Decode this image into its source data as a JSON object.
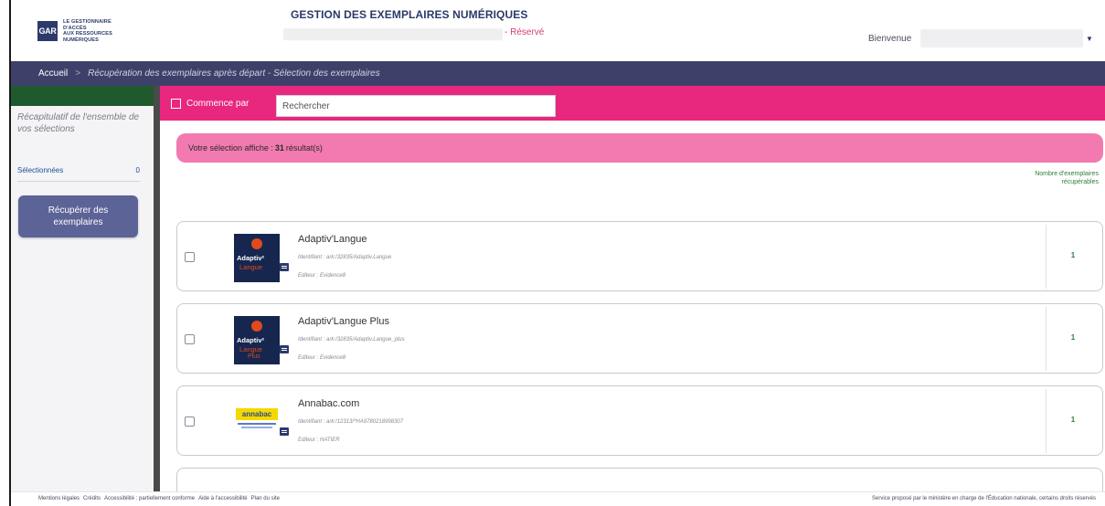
{
  "header": {
    "logo_abbr": "GAR",
    "logo_lines": [
      "LE GESTIONNAIRE",
      "D'ACCÈS",
      "AUX RESSOURCES",
      "NUMÉRIQUES"
    ],
    "title": "GESTION DES EXEMPLAIRES NUMÉRIQUES",
    "reserved": "- Réservé",
    "welcome": "Bienvenue"
  },
  "breadcrumb": {
    "home": "Accueil",
    "separator": ">",
    "current": "Récupération des exemplaires après départ - Sélection des exemplaires"
  },
  "sidebar": {
    "recap": "Récapitulatif de l'ensemble de vos sélections",
    "selected_label": "Sélectionnées",
    "selected_count": "0",
    "recover_button": "Récupérer des exemplaires"
  },
  "search": {
    "commence_label": "Commence par",
    "placeholder": "Rechercher"
  },
  "results": {
    "summary_prefix": "Votre sélection affiche :",
    "count": "31",
    "summary_suffix": "résultat(s)",
    "column_header": "Nombre d'exemplaires récupérables"
  },
  "items": [
    {
      "title": "Adaptiv'Langue",
      "identifier": "Identifiant : ark:/32835/Adaptiv.Langue",
      "publisher": "Editeur : Evidence8",
      "count": "1",
      "logo_lines": [
        "Adaptiv²",
        "Langue",
        ""
      ]
    },
    {
      "title": "Adaptiv'Langue Plus",
      "identifier": "Identifiant : ark:/32835/Adaptiv.Langue_plus",
      "publisher": "Editeur : Evidence8",
      "count": "1",
      "logo_lines": [
        "Adaptiv²",
        "Langue",
        "Plus"
      ]
    },
    {
      "title": "Annabac.com",
      "identifier": "Identifiant : ark:/12313/*HA9780218998307",
      "publisher": "Editeur : HATIER",
      "count": "1",
      "logo_lines": [
        "annabac"
      ]
    }
  ],
  "footer": {
    "links": [
      "Mentions légales",
      "Crédits",
      "Accessibilité : partiellement conforme",
      "Aide à l'accessibilité",
      "Plan du site"
    ],
    "right": "Service proposé par le ministère en charge de l'Éducation nationale, certains droits réservés"
  }
}
